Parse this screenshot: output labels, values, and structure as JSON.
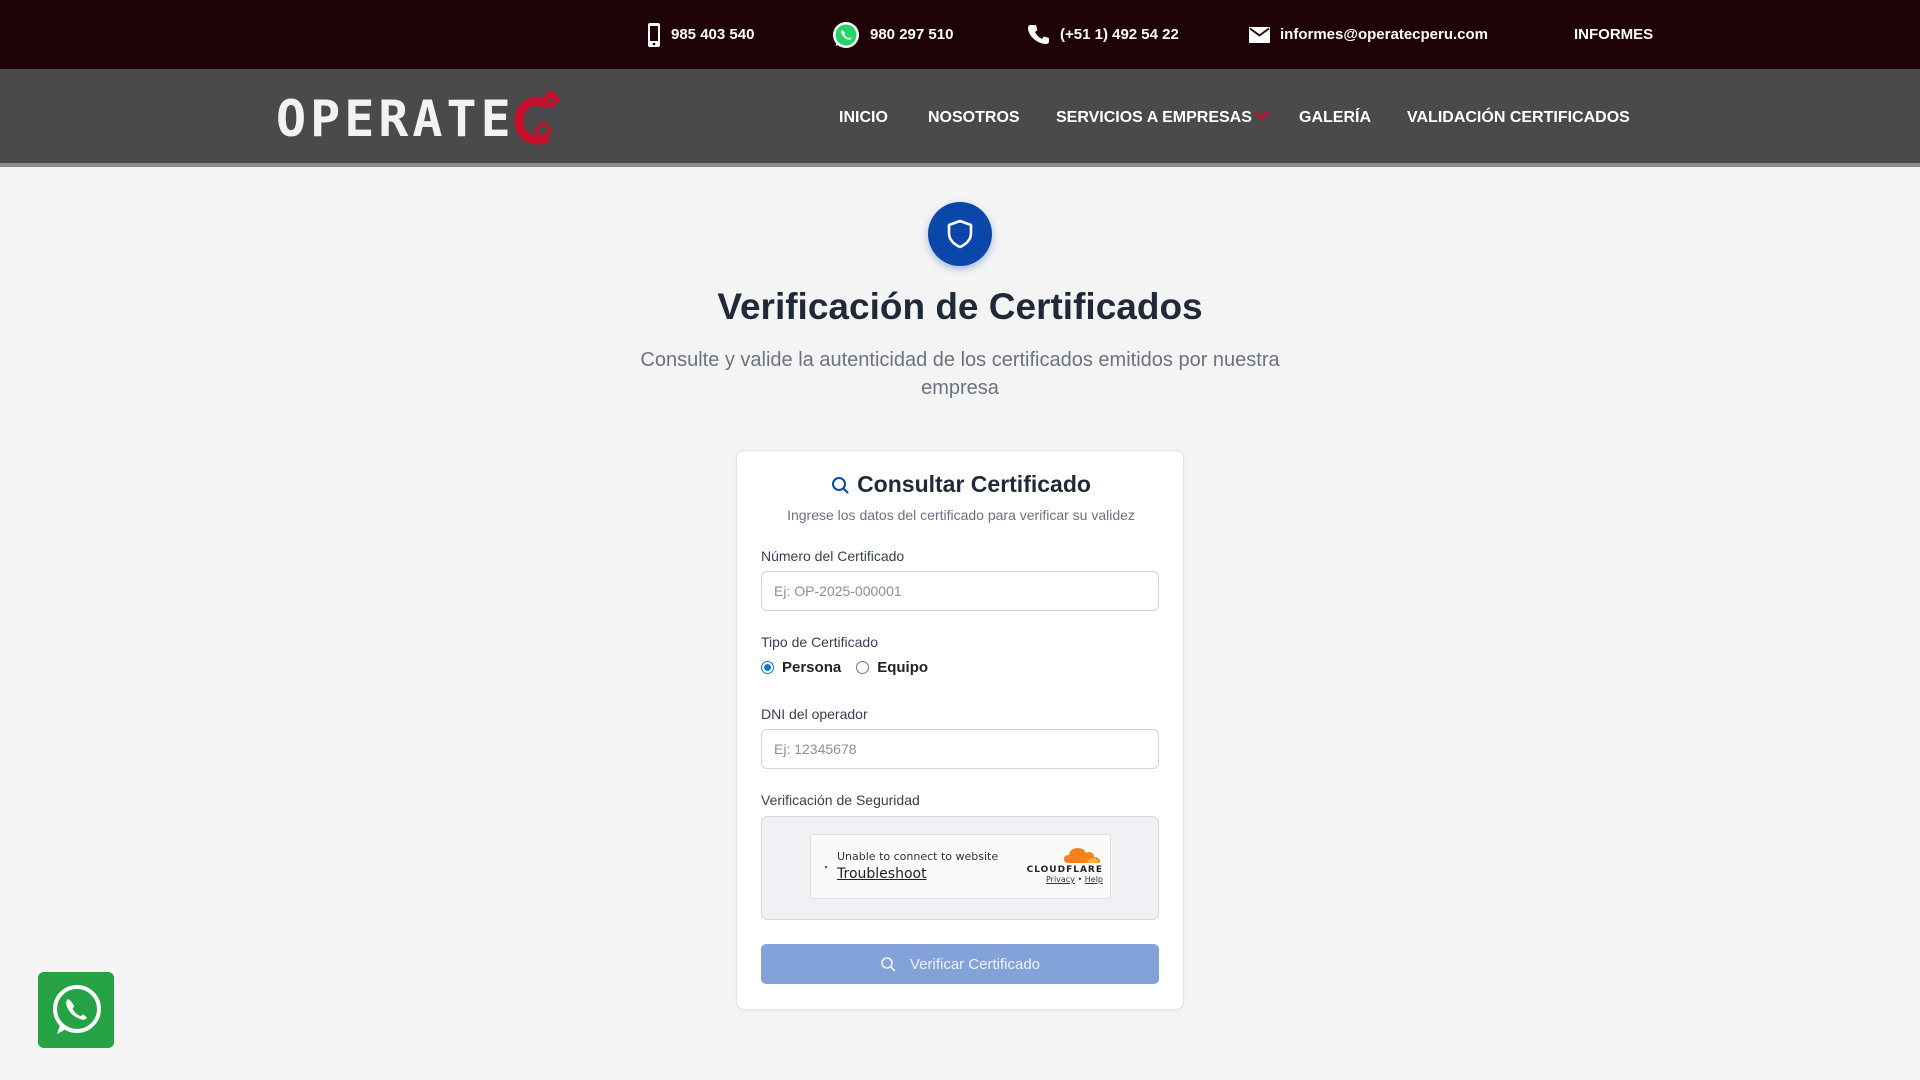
{
  "topbar": {
    "mobile": "985 403 540",
    "whatsapp": "980 297 510",
    "phone": "(+51 1) 492 54 22",
    "email": "informes@operatecperu.com",
    "informes": "INFORMES"
  },
  "nav": {
    "logo": "OPERATE",
    "items": [
      "INICIO",
      "NOSOTROS",
      "SERVICIOS A EMPRESAS",
      "GALERÍA",
      "VALIDACIÓN CERTIFICADOS"
    ]
  },
  "hero": {
    "title": "Verificación de Certificados",
    "subtitle": "Consulte y valide la autenticidad de los certificados emitidos por nuestra empresa"
  },
  "form": {
    "title": "Consultar Certificado",
    "subtitle": "Ingrese los datos del certificado para verificar su validez",
    "cert_number_label": "Número del Certificado",
    "cert_number_placeholder": "Ej: OP-2025-000001",
    "cert_type_label": "Tipo de Certificado",
    "type_options": [
      "Persona",
      "Equipo"
    ],
    "type_selected": "Persona",
    "dni_label": "DNI del operador",
    "dni_placeholder": "Ej: 12345678",
    "security_label": "Verificación de Seguridad",
    "turnstile_msg": "Unable to connect to website",
    "turnstile_link": "Troubleshoot",
    "cf_brand": "CLOUDFLARE",
    "cf_privacy": "Privacy",
    "cf_sep": "•",
    "cf_help": "Help",
    "submit_label": "Verificar Certificado"
  },
  "colors": {
    "topbar": "#1f0207",
    "navbar": "#4a4a4a",
    "accent_red": "#c8102e",
    "primary_blue": "#0b47a8",
    "button_disabled": "#82a2d9",
    "whatsapp_green": "#25a244"
  },
  "icons": [
    "mobile-icon",
    "whatsapp-icon",
    "phone-icon",
    "mail-icon",
    "chevron-down-icon",
    "shield-icon",
    "search-icon",
    "cloudflare-icon",
    "whatsapp-float-icon"
  ]
}
